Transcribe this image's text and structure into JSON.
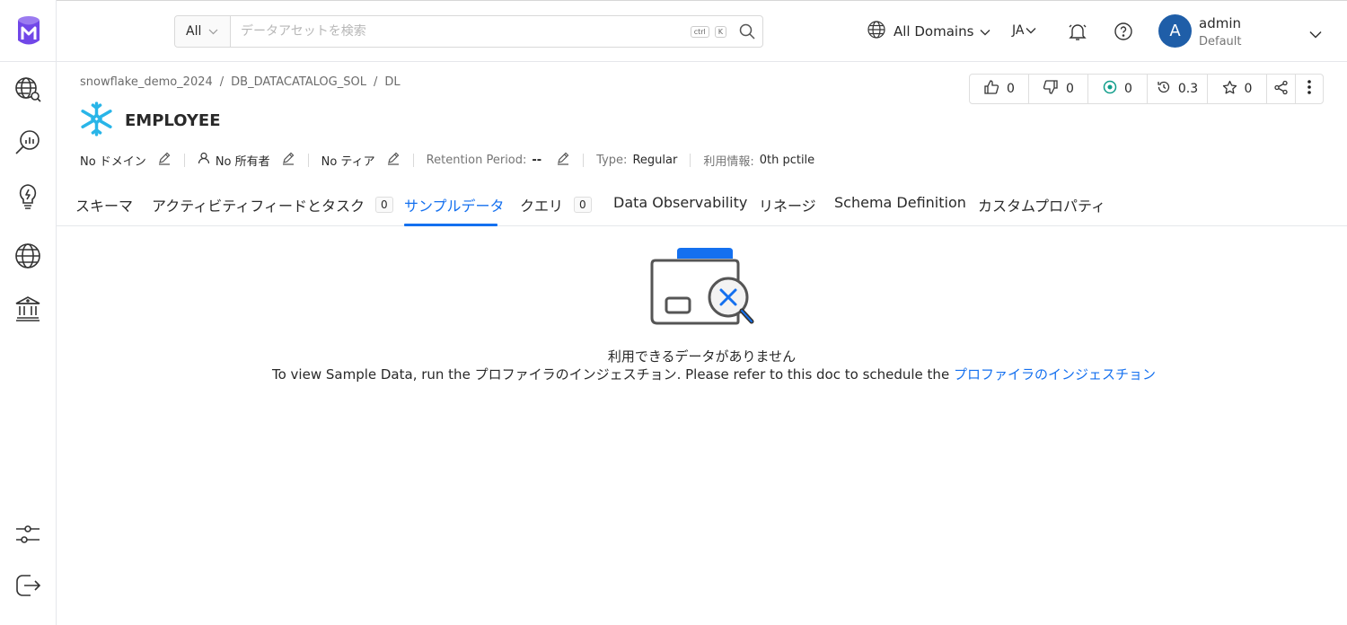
{
  "header": {
    "search_scope": "All",
    "search_placeholder": "データアセットを検索",
    "kbd_ctrl": "ctrl",
    "kbd_k": "K",
    "domains_label": "All Domains",
    "language": "JA",
    "user": {
      "initial": "A",
      "name": "admin",
      "role": "Default"
    }
  },
  "sidebar": {
    "items": [
      {
        "name": "explore",
        "icon": "globe-search-icon"
      },
      {
        "name": "data-quality",
        "icon": "chart-search-icon"
      },
      {
        "name": "insights",
        "icon": "lightbulb-icon"
      },
      {
        "name": "domains",
        "icon": "globe-icon"
      },
      {
        "name": "governance",
        "icon": "bank-icon"
      }
    ],
    "bottom": [
      {
        "name": "settings",
        "icon": "sliders-icon"
      },
      {
        "name": "logout",
        "icon": "logout-icon"
      }
    ]
  },
  "breadcrumb": [
    "snowflake_demo_2024",
    "DB_DATACATALOG_SOL",
    "DL"
  ],
  "entity": {
    "name": "EMPLOYEE"
  },
  "actions": {
    "up_votes": "0",
    "down_votes": "0",
    "followers": "0",
    "version": "0.3",
    "stars": "0"
  },
  "meta": {
    "domain": "No ドメイン",
    "owner": "No 所有者",
    "tier": "No ティア",
    "retention_label": "Retention Period:",
    "retention_value": "--",
    "type_label": "Type:",
    "type_value": "Regular",
    "usage_label": "利用情報:",
    "usage_value": "0th pctile"
  },
  "tabs": [
    {
      "label": "スキーマ"
    },
    {
      "label": "アクティビティフィードとタスク",
      "count": "0"
    },
    {
      "label": "サンプルデータ",
      "active": true
    },
    {
      "label": "クエリ",
      "count": "0"
    },
    {
      "label": "Data Observability"
    },
    {
      "label": "リネージ"
    },
    {
      "label": "Schema Definition"
    },
    {
      "label": "カスタムプロパティ"
    }
  ],
  "empty_state": {
    "title": "利用できるデータがありません",
    "message": "To view Sample Data, run the プロファイラのインジェスチョン. Please refer to this doc to schedule the ",
    "link": "プロファイラのインジェスチョン"
  },
  "colors": {
    "accent": "#1470ef",
    "avatar": "#1f5ea8",
    "snowflake": "#29b5e8",
    "logo": "#7147e8"
  }
}
